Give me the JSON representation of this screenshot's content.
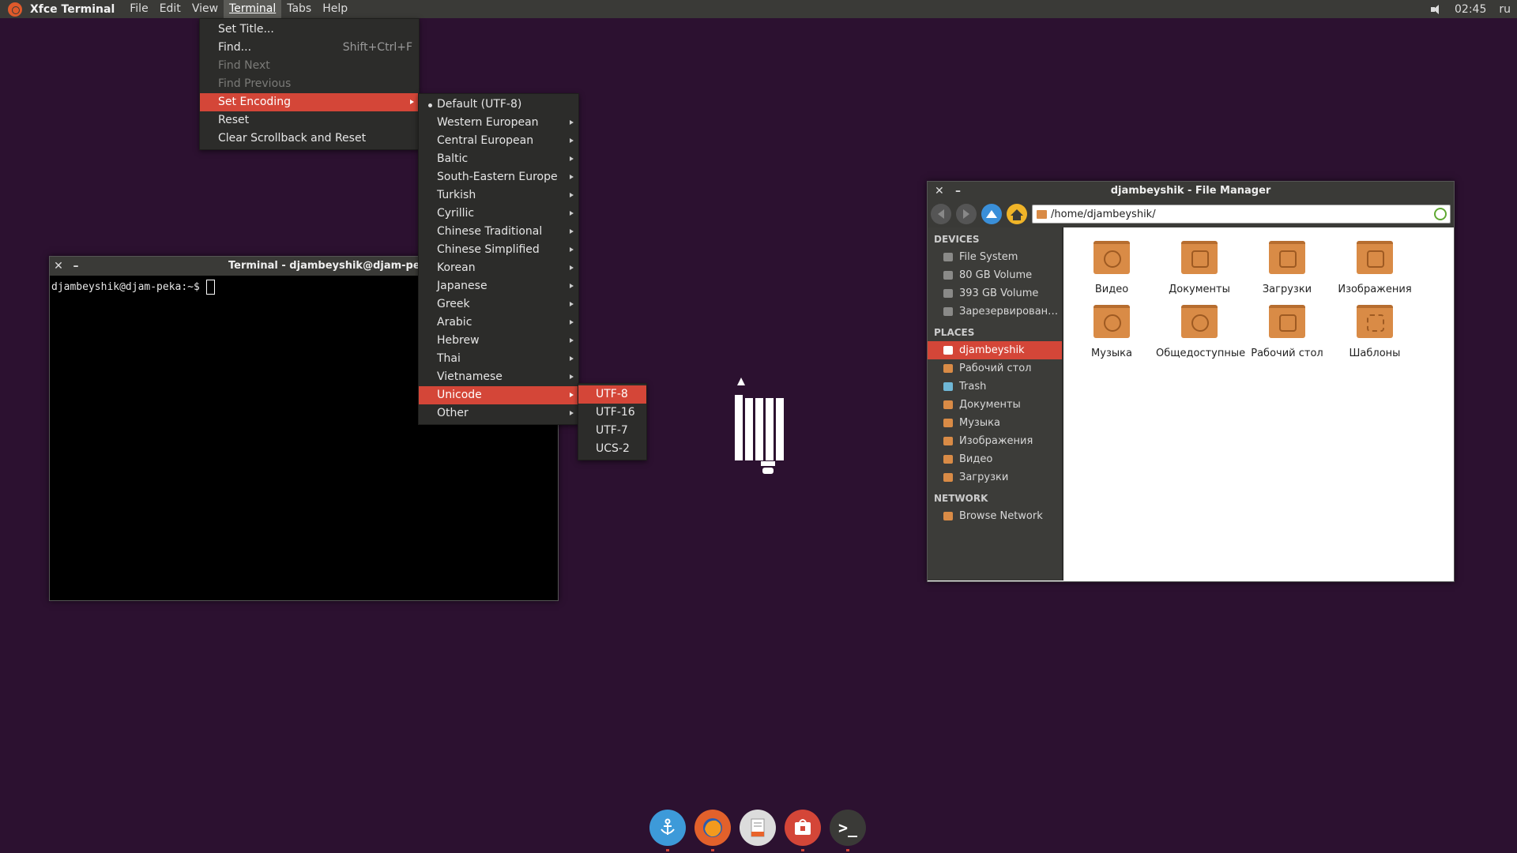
{
  "top_panel": {
    "app_title": "Xfce Terminal",
    "menus": [
      "File",
      "Edit",
      "View",
      "Terminal",
      "Tabs",
      "Help"
    ],
    "clock": "02:45",
    "keyboard_layout": "ru"
  },
  "terminal_menu": {
    "items": [
      {
        "label": "Set Title...",
        "accel": ""
      },
      {
        "label": "Find...",
        "accel": "Shift+Ctrl+F"
      },
      {
        "label": "Find Next",
        "accel": ""
      },
      {
        "label": "Find Previous",
        "accel": ""
      },
      {
        "label": "Set Encoding",
        "accel": ""
      },
      {
        "label": "Reset",
        "accel": ""
      },
      {
        "label": "Clear Scrollback and Reset",
        "accel": ""
      }
    ]
  },
  "encoding_menu": {
    "items": [
      "Default (UTF-8)",
      "Western European",
      "Central European",
      "Baltic",
      "South-Eastern Europe",
      "Turkish",
      "Cyrillic",
      "Chinese Traditional",
      "Chinese Simplified",
      "Korean",
      "Japanese",
      "Greek",
      "Arabic",
      "Hebrew",
      "Thai",
      "Vietnamese",
      "Unicode",
      "Other"
    ]
  },
  "unicode_menu": {
    "items": [
      "UTF-8",
      "UTF-16",
      "UTF-7",
      "UCS-2"
    ]
  },
  "terminal_window": {
    "title": "Terminal - djambeyshik@djam-peka: ~",
    "close": "✕",
    "minimize": "–",
    "prompt": "djambeyshik@djam-peka:~$"
  },
  "file_manager": {
    "title": "djambeyshik - File Manager",
    "close": "✕",
    "minimize": "–",
    "path": "/home/djambeyshik/",
    "sections": {
      "devices": "DEVICES",
      "places": "PLACES",
      "network": "NETWORK"
    },
    "devices": [
      "File System",
      "80 GB Volume",
      "393 GB Volume",
      "Зарезервировано ..."
    ],
    "places": [
      "djambeyshik",
      "Рабочий стол",
      "Trash",
      "Документы",
      "Музыка",
      "Изображения",
      "Видео",
      "Загрузки"
    ],
    "network": [
      "Browse Network"
    ],
    "folders": [
      "Видео",
      "Документы",
      "Загрузки",
      "Изображения",
      "Музыка",
      "Общедоступные",
      "Рабочий стол",
      "Шаблоны"
    ]
  },
  "dock": {
    "terminal_glyph": ">_"
  },
  "colors": {
    "desktop": "#2c1130",
    "accent": "#d44638",
    "panel": "#3a3a37"
  }
}
